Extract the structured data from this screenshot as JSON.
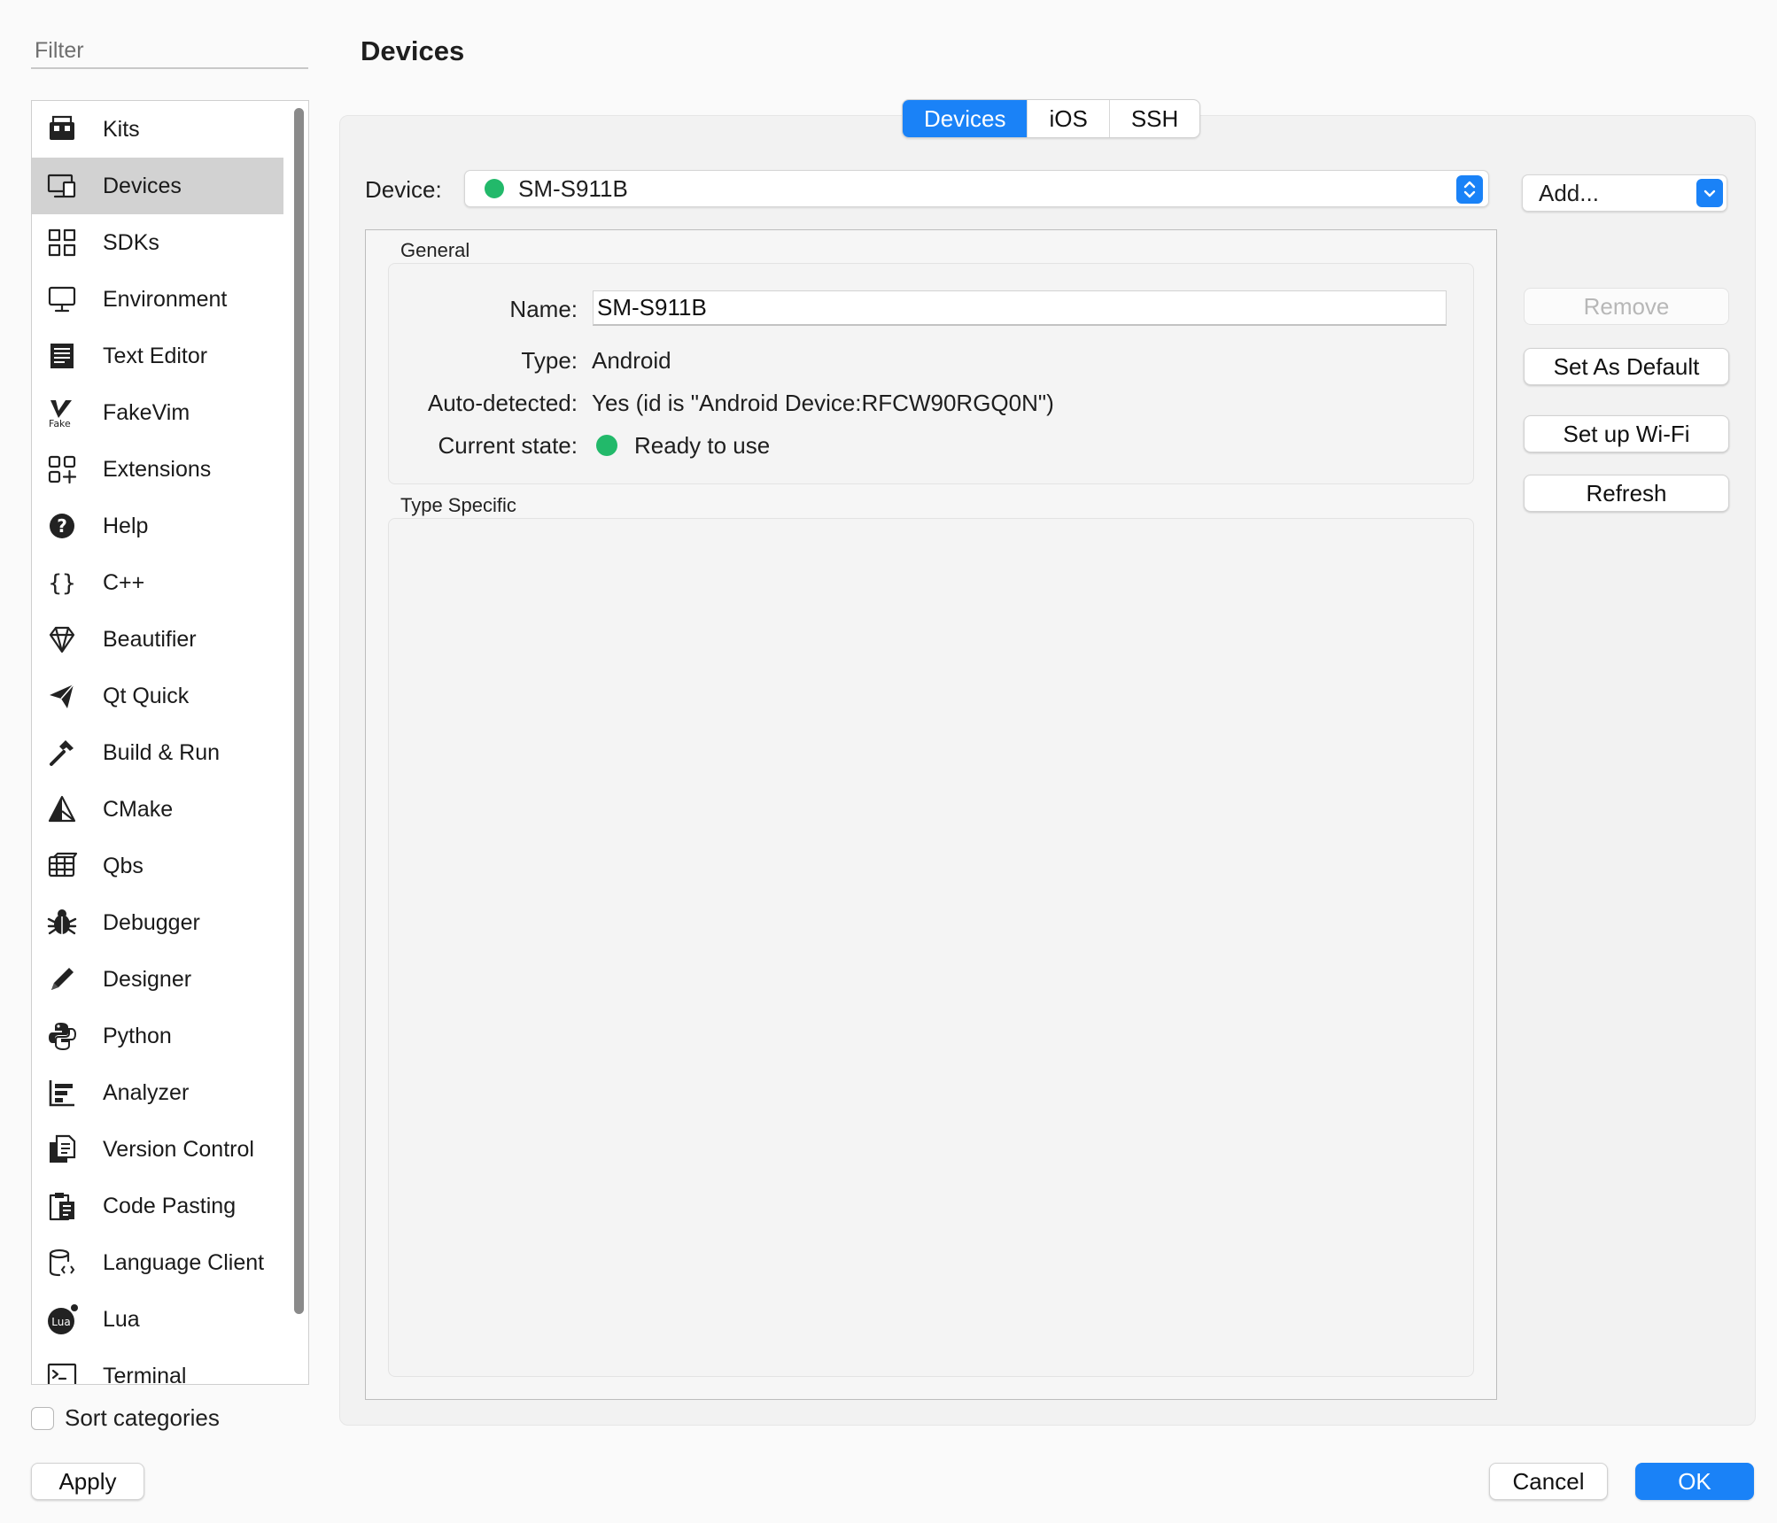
{
  "sidebar": {
    "filter_placeholder": "Filter",
    "items": [
      {
        "label": "Kits",
        "icon": "kits-icon"
      },
      {
        "label": "Devices",
        "icon": "devices-icon",
        "selected": true
      },
      {
        "label": "SDKs",
        "icon": "sdks-icon"
      },
      {
        "label": "Environment",
        "icon": "environment-icon"
      },
      {
        "label": "Text Editor",
        "icon": "text-editor-icon"
      },
      {
        "label": "FakeVim",
        "icon": "fakevim-icon"
      },
      {
        "label": "Extensions",
        "icon": "extensions-icon"
      },
      {
        "label": "Help",
        "icon": "help-icon"
      },
      {
        "label": "C++",
        "icon": "cpp-braces-icon"
      },
      {
        "label": "Beautifier",
        "icon": "beautifier-icon"
      },
      {
        "label": "Qt Quick",
        "icon": "qt-quick-icon"
      },
      {
        "label": "Build & Run",
        "icon": "hammer-icon"
      },
      {
        "label": "CMake",
        "icon": "cmake-icon"
      },
      {
        "label": "Qbs",
        "icon": "qbs-icon"
      },
      {
        "label": "Debugger",
        "icon": "bug-icon"
      },
      {
        "label": "Designer",
        "icon": "pencil-icon"
      },
      {
        "label": "Python",
        "icon": "python-icon"
      },
      {
        "label": "Analyzer",
        "icon": "analyzer-icon"
      },
      {
        "label": "Version Control",
        "icon": "version-control-icon"
      },
      {
        "label": "Code Pasting",
        "icon": "clipboard-icon"
      },
      {
        "label": "Language Client",
        "icon": "language-client-icon"
      },
      {
        "label": "Lua",
        "icon": "lua-icon"
      },
      {
        "label": "Terminal",
        "icon": "terminal-icon"
      }
    ],
    "sort_label": "Sort categories",
    "sort_checked": false
  },
  "header": {
    "title": "Devices"
  },
  "tabs": [
    {
      "label": "Devices",
      "active": true
    },
    {
      "label": "iOS",
      "active": false
    },
    {
      "label": "SSH",
      "active": false
    }
  ],
  "device": {
    "label": "Device:",
    "selected": "SM-S911B",
    "status_color": "#22b96a"
  },
  "actions": {
    "add": "Add...",
    "remove": "Remove",
    "set_default": "Set As Default",
    "setup_wifi": "Set up Wi-Fi",
    "refresh": "Refresh"
  },
  "general": {
    "title": "General",
    "name_label": "Name:",
    "name_value": "SM-S911B",
    "type_label": "Type:",
    "type_value": "Android",
    "auto_label": "Auto-detected:",
    "auto_value": "Yes (id is \"Android Device:RFCW90RGQ0N\")",
    "state_label": "Current state:",
    "state_value": "Ready to use"
  },
  "type_specific": {
    "title": "Type Specific"
  },
  "footer": {
    "apply": "Apply",
    "cancel": "Cancel",
    "ok": "OK"
  },
  "colors": {
    "accent": "#1a82f7",
    "selected_row": "#d2d2d2",
    "ready": "#22b96a"
  }
}
